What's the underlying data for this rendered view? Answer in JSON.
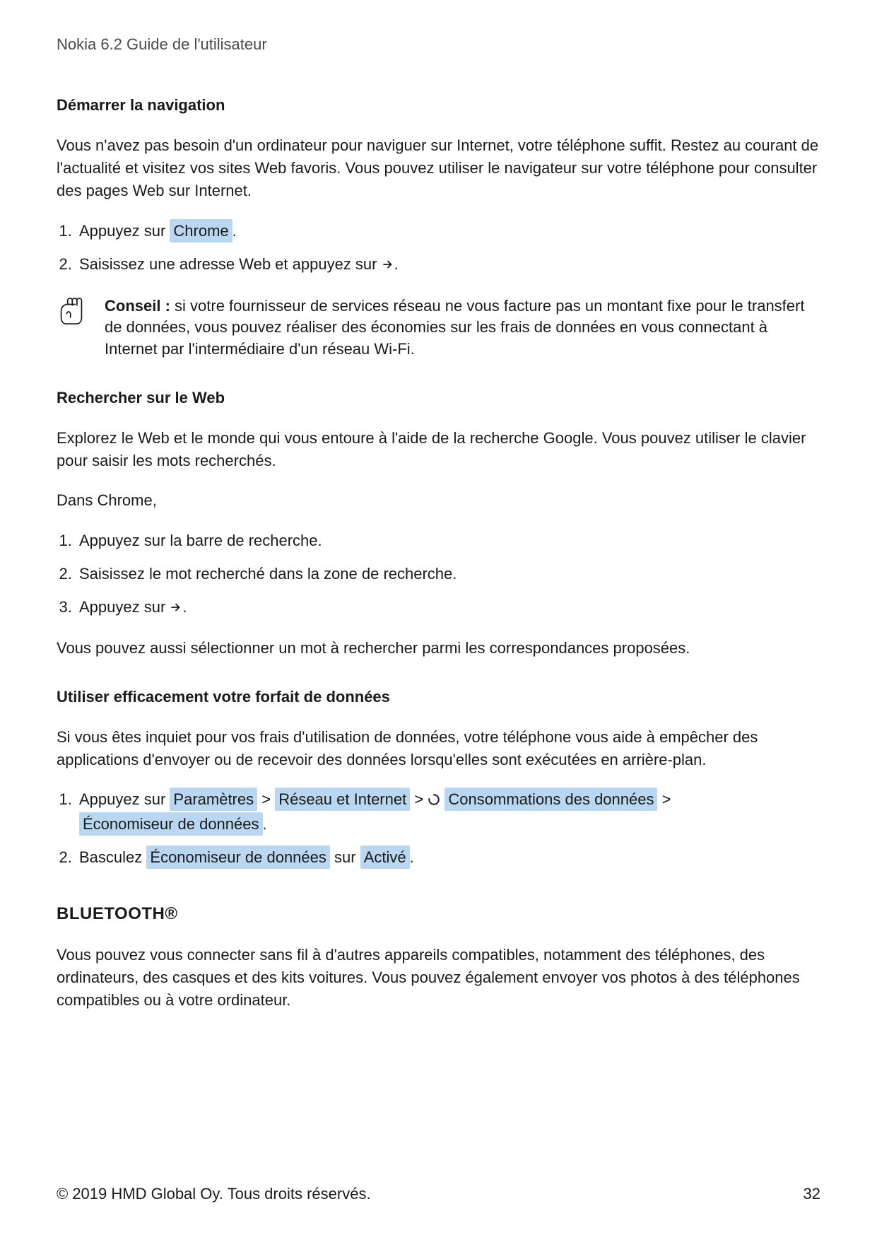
{
  "header": {
    "doc_title": "Nokia 6.2 Guide de l'utilisateur"
  },
  "section1": {
    "heading": "Démarrer la navigation",
    "intro": "Vous n'avez pas besoin d'un ordinateur pour naviguer sur Internet, votre téléphone suffit. Restez au courant de l'actualité et visitez vos sites Web favoris. Vous pouvez utiliser le navigateur sur votre téléphone pour consulter des pages Web sur Internet.",
    "step1_prefix": "Appuyez sur ",
    "step1_chip": "Chrome",
    "step1_suffix": ".",
    "step2_prefix": "Saisissez une adresse Web et appuyez sur ",
    "step2_suffix": ".",
    "tip_label": "Conseil :",
    "tip_body": " si votre fournisseur de services réseau ne vous facture pas un montant fixe pour le transfert de données, vous pouvez réaliser des économies sur les frais de données en vous connectant à Internet par l'intermédiaire d'un réseau Wi-Fi."
  },
  "section2": {
    "heading": "Rechercher sur le Web",
    "intro": "Explorez le Web et le monde qui vous entoure à l'aide de la recherche Google. Vous pouvez utiliser le clavier pour saisir les mots recherchés.",
    "subline": "Dans Chrome,",
    "step1": "Appuyez sur la barre de recherche.",
    "step2": "Saisissez le mot recherché dans la zone de recherche.",
    "step3_prefix": "Appuyez sur ",
    "step3_suffix": ".",
    "outro": "Vous pouvez aussi sélectionner un mot à rechercher parmi les correspondances proposées."
  },
  "section3": {
    "heading": "Utiliser efficacement votre forfait de données",
    "intro": "Si vous êtes inquiet pour vos frais d'utilisation de données, votre téléphone vous aide à empêcher des applications d'envoyer ou de recevoir des données lorsqu'elles sont exécutées en arrière-plan.",
    "step1_prefix": "Appuyez sur ",
    "chip_settings": "Paramètres",
    "sep": " > ",
    "chip_network": "Réseau et Internet",
    "chip_data_usage": "Consommations des données",
    "chip_data_saver": "Économiseur de données",
    "step1_suffix": ".",
    "step2_prefix": "Basculez ",
    "step2_chip1": "Économiseur de données",
    "step2_mid": " sur ",
    "step2_chip2": "Activé",
    "step2_suffix": "."
  },
  "section4": {
    "heading": "BLUETOOTH®",
    "intro": "Vous pouvez vous connecter sans fil à d'autres appareils compatibles, notamment des téléphones, des ordinateurs, des casques et des kits voitures. Vous pouvez également envoyer vos photos à des téléphones compatibles ou à votre ordinateur."
  },
  "footer": {
    "copyright": "© 2019 HMD Global Oy. Tous droits réservés.",
    "page_number": "32"
  }
}
